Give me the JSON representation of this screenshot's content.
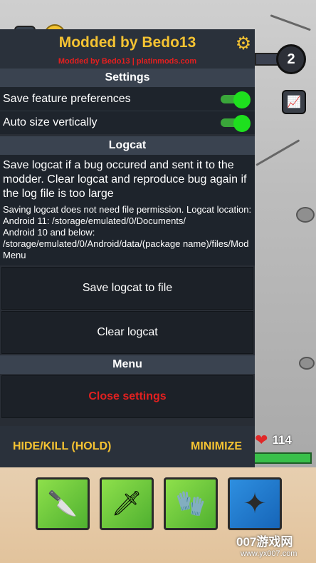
{
  "game": {
    "pause_label": "II",
    "level": "2",
    "hp": "114",
    "watermark": "007游戏网",
    "watermark_url": "www.yx007.com",
    "inventory": [
      {
        "name": "knife",
        "icon": "🔪"
      },
      {
        "name": "sword",
        "icon": "🗡"
      },
      {
        "name": "glove",
        "icon": "🧤"
      },
      {
        "name": "shuriken",
        "icon": "✦"
      }
    ]
  },
  "mod_menu": {
    "title": "Modded by Bedo13",
    "subtitle": "Modded by Bedo13 | platinmods.com",
    "settings_heading": "Settings",
    "toggles": [
      {
        "label": "Save feature preferences",
        "on": true
      },
      {
        "label": "Auto size vertically",
        "on": true
      }
    ],
    "logcat_heading": "Logcat",
    "logcat_main": "Save logcat if a bug occured and sent it to the modder. Clear logcat and reproduce bug again if the log file is too large",
    "logcat_info_1": "Saving logcat does not need file permission. Logcat location:",
    "logcat_info_2": "Android 11: /storage/emulated/0/Documents/",
    "logcat_info_3": "Android 10 and below: /storage/emulated/0/Android/data/(package name)/files/Mod Menu",
    "save_logcat_label": "Save logcat to file",
    "clear_logcat_label": "Clear logcat",
    "menu_heading": "Menu",
    "close_settings_label": "Close settings",
    "hide_kill_label": "HIDE/KILL (HOLD)",
    "minimize_label": "MINIMIZE"
  },
  "colors": {
    "accent": "#f5c332",
    "danger": "#e12020",
    "toggle_on": "#1ee01e"
  }
}
